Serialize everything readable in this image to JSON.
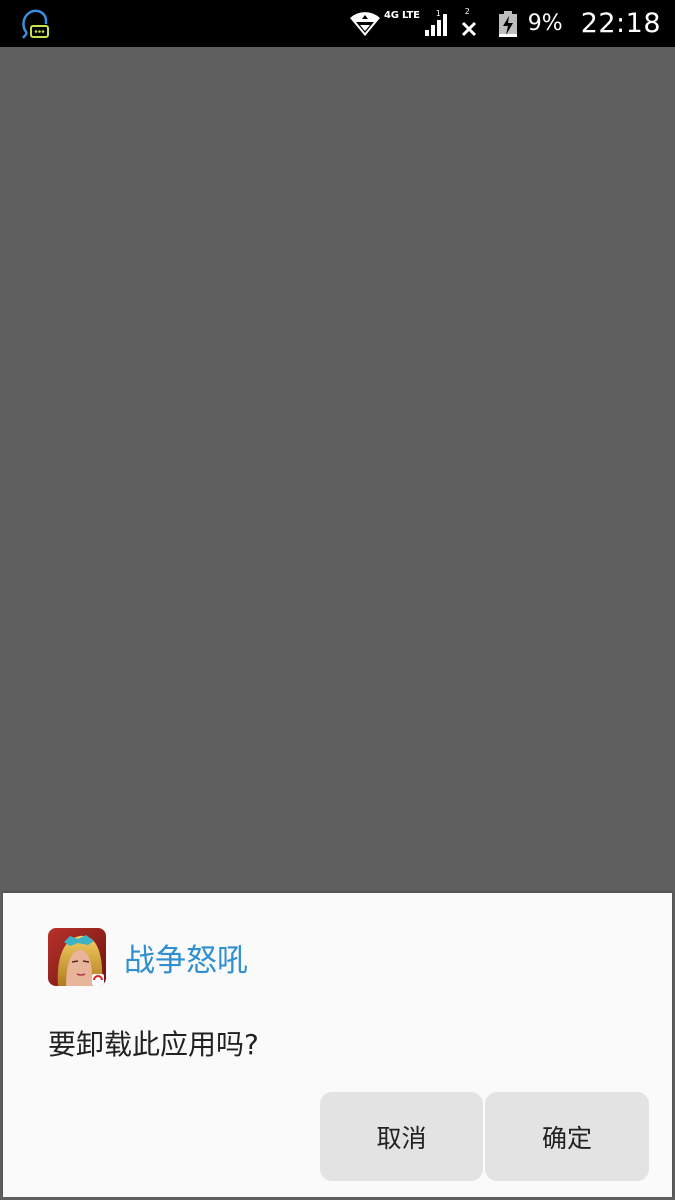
{
  "status_bar": {
    "notification_icon": "chat-assistant-icon",
    "network_type": "4G LTE",
    "sim1_label": "1",
    "sim2_label": "2",
    "battery_percent": "9%",
    "time": "22:18",
    "icons": [
      "wifi-icon",
      "signal-icon",
      "no-signal-icon",
      "battery-charging-icon"
    ]
  },
  "dialog": {
    "app_icon": "app-icon",
    "app_name": "战争怒吼",
    "message": "要卸载此应用吗?",
    "cancel_label": "取消",
    "ok_label": "确定"
  },
  "colors": {
    "status_bar_bg": "#000000",
    "scrim": "#5f5f5f",
    "dialog_bg": "#fafafa",
    "app_name": "#2f8fd0",
    "button_bg": "#e3e3e3"
  }
}
